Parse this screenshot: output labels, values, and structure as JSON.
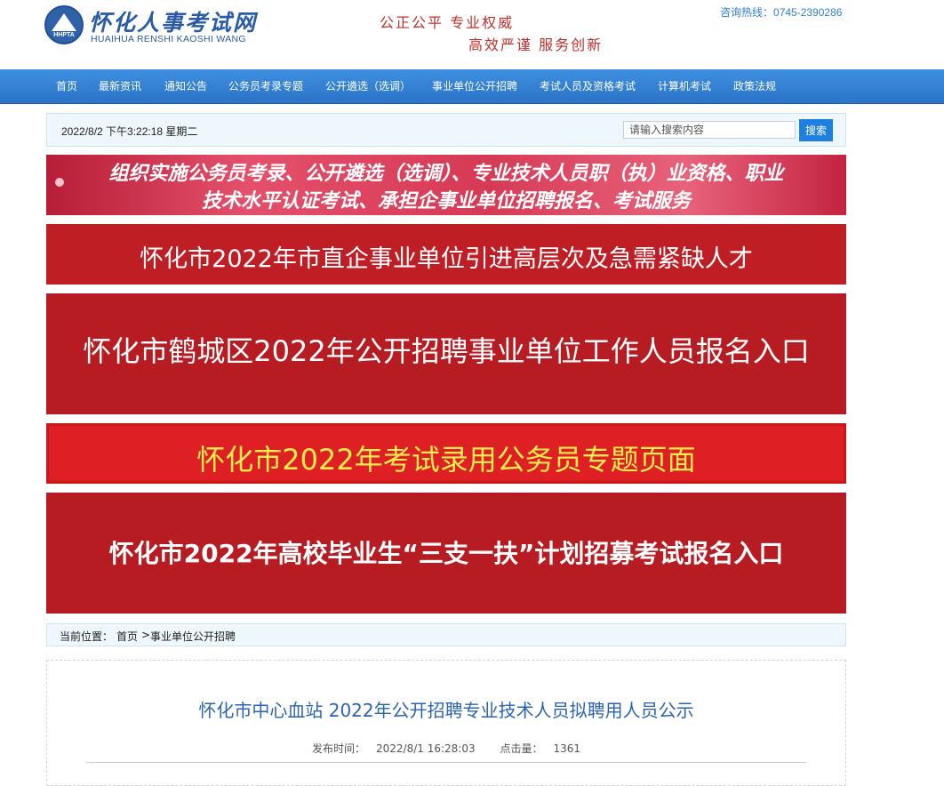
{
  "header": {
    "logo_cn": "怀化人事考试网",
    "logo_en": "HUAIHUA RENSHI KAOSHI WANG",
    "logo_tag": "HHPTA",
    "slogan_line1": "公正公平   专业权威",
    "slogan_line2": "高效严谨   服务创新",
    "hotline_label": "咨询热线：",
    "hotline_number": "0745-2390286"
  },
  "nav": {
    "items": [
      {
        "label": "首页"
      },
      {
        "label": "最新资讯"
      },
      {
        "label": "通知公告"
      },
      {
        "label": "公务员考录专题"
      },
      {
        "label": "公开遴选（选调）"
      },
      {
        "label": "事业单位公开招聘"
      },
      {
        "label": "考试人员及资格考试"
      },
      {
        "label": "计算机考试"
      },
      {
        "label": "政策法规"
      }
    ]
  },
  "datebar": {
    "datetime": "2022/8/2 下午3:22:18 星期二",
    "search_placeholder": "请输入搜索内容",
    "search_button": "搜索"
  },
  "banners": {
    "mission_line1": "组织实施公务员考录、公开遴选（选调）、专业技术人员职（执）业资格、职业",
    "mission_line2": "技术水平认证考试、承担企事业单位招聘报名、考试服务",
    "talent": "怀化市2022年市直企事业单位引进高层次及急需紧缺人才",
    "hecheng": "怀化市鹤城区2022年公开招聘事业单位工作人员报名入口",
    "civil_servant": "怀化市2022年考试录用公务员专题页面",
    "sanzhiyifu": "怀化市2022年高校毕业生“三支一扶”计划招募考试报名入口"
  },
  "breadcrumb": {
    "label": "当前位置：",
    "home": "首页",
    "separator": ">",
    "current": "事业单位公开招聘"
  },
  "article": {
    "title": "怀化市中心血站 2022年公开招聘专业技术人员拟聘用人员公示",
    "published_label": "发布时间：",
    "published_value": "2022/8/1 16:28:03",
    "views_label": "点击量：",
    "views_value": "1361"
  },
  "colors": {
    "brand_blue": "#2a5ba5",
    "nav_blue": "#2b74c8",
    "slogan_red": "#c0302b",
    "banner_red": "#b71c22",
    "banner_yellow_text": "#ffec4d"
  }
}
